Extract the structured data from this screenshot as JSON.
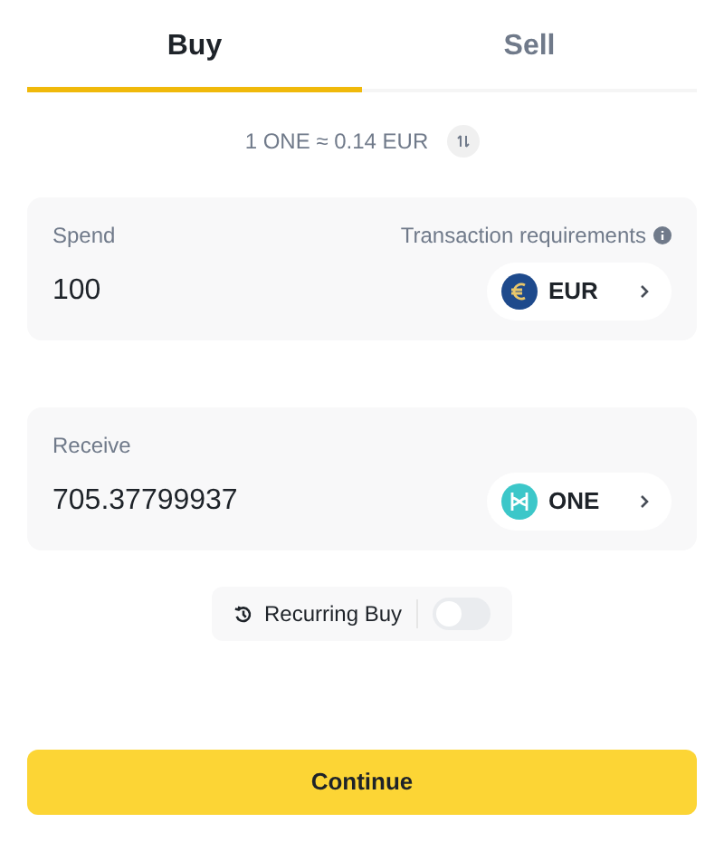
{
  "tabs": [
    {
      "label": "Buy",
      "selected": true
    },
    {
      "label": "Sell",
      "selected": false
    }
  ],
  "rate": "1 ONE ≈ 0.14 EUR",
  "spend": {
    "label": "Spend",
    "requirements": "Transaction requirements",
    "value": "100",
    "currency": {
      "code": "EUR",
      "kind": "fiat"
    }
  },
  "receive": {
    "label": "Receive",
    "value": "705.37799937",
    "currency": {
      "code": "ONE",
      "kind": "crypto"
    }
  },
  "recurring_buy": {
    "label": "Recurring Buy",
    "on": false
  },
  "continue_button": "Continue"
}
